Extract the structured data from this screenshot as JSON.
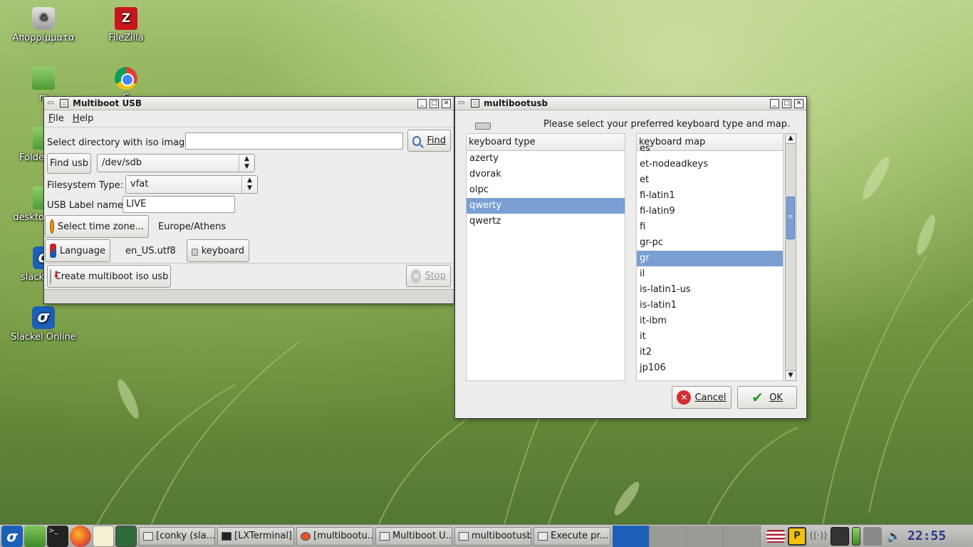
{
  "desktop": {
    "icons": [
      {
        "label": "Απορρίμματα",
        "icon": "trash-icon"
      },
      {
        "label": "FileZilla",
        "icon": "filezilla-icon"
      },
      {
        "label": "m",
        "icon": "folder-icon"
      },
      {
        "label": "G",
        "icon": "chrome-icon"
      },
      {
        "label": "Folde",
        "icon": "folder-icon"
      },
      {
        "label": "deskto",
        "icon": "folder-icon"
      },
      {
        "label": "slack",
        "icon": "slackel-icon"
      },
      {
        "label": "Slackel Online",
        "icon": "slackel-icon"
      }
    ]
  },
  "main_window": {
    "title": "Multiboot USB",
    "menu": {
      "file": "File",
      "help": "Help"
    },
    "iso_dir_label": "Select directory with iso images:",
    "iso_dir_value": "",
    "find_button": "Find",
    "find_usb_button": "Find usb",
    "usb_device": "/dev/sdb",
    "filesystem_label": "Filesystem Type:",
    "filesystem_value": "vfat",
    "usb_label_label": "USB Label name:",
    "usb_label_value": "LIVE",
    "timezone_button": "Select time zone...",
    "timezone_value": "Europe/Athens",
    "language_button": "Language",
    "language_value": "en_US.utf8",
    "keyboard_button": "keyboard",
    "create_button": "Create multiboot iso usb",
    "stop_button": "Stop"
  },
  "keyboard_dialog": {
    "title": "multibootusb",
    "prompt": "Please select your preferred keyboard type and map.",
    "type_header": "keyboard type",
    "types": [
      "azerty",
      "dvorak",
      "olpc",
      "qwerty",
      "qwertz"
    ],
    "selected_type": "qwerty",
    "map_header": "keyboard map",
    "maps": [
      "es",
      "et-nodeadkeys",
      "et",
      "fi-latin1",
      "fi-latin9",
      "fi",
      "gr-pc",
      "gr",
      "il",
      "is-latin1-us",
      "is-latin1",
      "it-ibm",
      "it",
      "it2",
      "jp106"
    ],
    "selected_map": "gr",
    "cancel_button": "Cancel",
    "ok_button": "OK"
  },
  "taskbar": {
    "tasks": [
      "[conky (sla...",
      "[LXTerminal]",
      "[multibootu...",
      "Multiboot U...",
      "multibootusb",
      "Execute pr..."
    ],
    "clock": "22:55"
  },
  "colors": {
    "selection": "#7b9fd3",
    "pager_active": "#1c5fb8"
  }
}
